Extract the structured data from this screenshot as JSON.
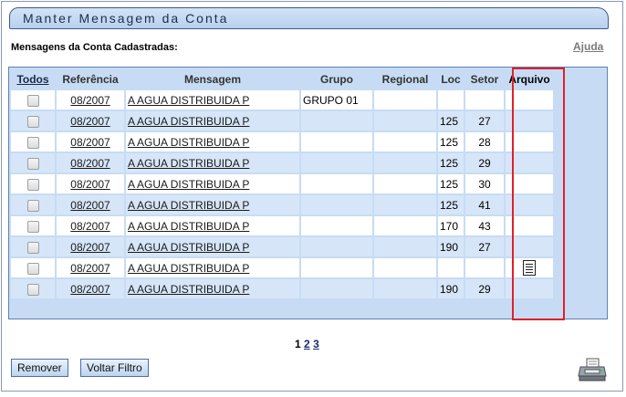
{
  "title": "Manter Mensagem da Conta",
  "subtitle": "Mensagens da Conta Cadastradas:",
  "help_link": "Ajuda",
  "columns": [
    "Todos",
    "Referência",
    "Mensagem",
    "Grupo",
    "Regional",
    "Loc",
    "Setor",
    "Arquivo"
  ],
  "rows": [
    {
      "ref": "08/2007",
      "msg": "A AGUA DISTRIBUIDA P",
      "grupo": "GRUPO 01",
      "regional": "",
      "loc": "",
      "setor": "",
      "arquivo": false
    },
    {
      "ref": "08/2007",
      "msg": "A AGUA DISTRIBUIDA P",
      "grupo": "",
      "regional": "",
      "loc": "125",
      "setor": "27",
      "arquivo": false
    },
    {
      "ref": "08/2007",
      "msg": "A AGUA DISTRIBUIDA P",
      "grupo": "",
      "regional": "",
      "loc": "125",
      "setor": "28",
      "arquivo": false
    },
    {
      "ref": "08/2007",
      "msg": "A AGUA DISTRIBUIDA P",
      "grupo": "",
      "regional": "",
      "loc": "125",
      "setor": "29",
      "arquivo": false
    },
    {
      "ref": "08/2007",
      "msg": "A AGUA DISTRIBUIDA P",
      "grupo": "",
      "regional": "",
      "loc": "125",
      "setor": "30",
      "arquivo": false
    },
    {
      "ref": "08/2007",
      "msg": "A AGUA DISTRIBUIDA P",
      "grupo": "",
      "regional": "",
      "loc": "125",
      "setor": "41",
      "arquivo": false
    },
    {
      "ref": "08/2007",
      "msg": "A AGUA DISTRIBUIDA P",
      "grupo": "",
      "regional": "",
      "loc": "170",
      "setor": "43",
      "arquivo": false
    },
    {
      "ref": "08/2007",
      "msg": "A AGUA DISTRIBUIDA P",
      "grupo": "",
      "regional": "",
      "loc": "190",
      "setor": "27",
      "arquivo": false
    },
    {
      "ref": "08/2007",
      "msg": "A AGUA DISTRIBUIDA P",
      "grupo": "",
      "regional": "",
      "loc": "",
      "setor": "",
      "arquivo": true
    },
    {
      "ref": "08/2007",
      "msg": "A AGUA DISTRIBUIDA P",
      "grupo": "",
      "regional": "",
      "loc": "190",
      "setor": "29",
      "arquivo": false
    }
  ],
  "pagination": {
    "current": "1",
    "pages": [
      "2",
      "3"
    ]
  },
  "buttons": {
    "remove": "Remover",
    "back_filter": "Voltar Filtro"
  },
  "icons": {
    "file": "document-icon",
    "print": "printer-icon",
    "checkbox": "checkbox"
  },
  "colors": {
    "header_bg": "#c7dcf4",
    "row_alt": "#d6e6f8",
    "highlight": "#e0202a"
  }
}
